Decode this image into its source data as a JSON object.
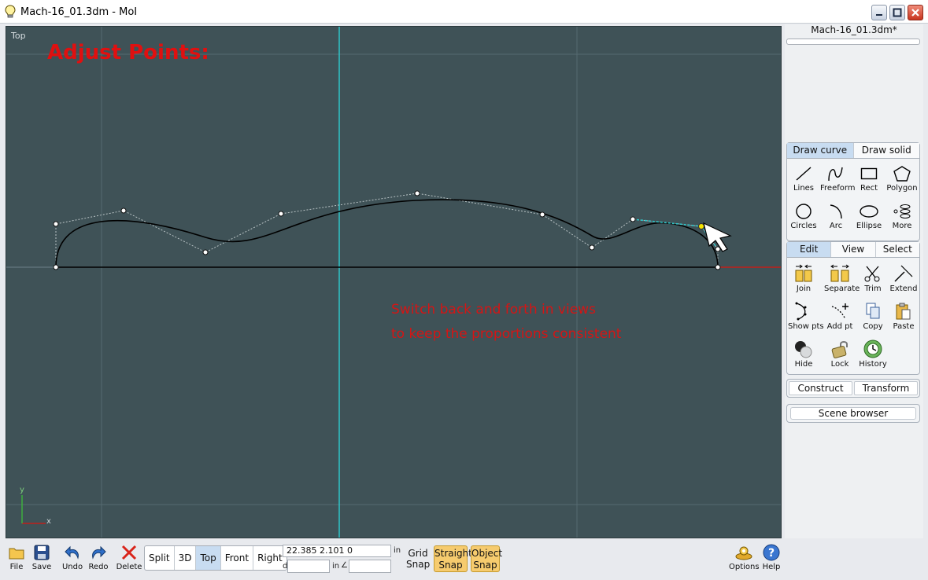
{
  "window": {
    "title": "Mach-16_01.3dm - MoI"
  },
  "viewport": {
    "name": "Top",
    "heading": "Adjust Points:",
    "note_line1": "Switch back and forth in views",
    "note_line2": "to keep the proportions consistent",
    "axis_x": "x",
    "axis_y": "y"
  },
  "panel": {
    "filename": "Mach-16_01.3dm*",
    "draw_tabs": [
      "Draw curve",
      "Draw solid"
    ],
    "draw_tools": [
      "Lines",
      "Freeform",
      "Rect",
      "Polygon",
      "Circles",
      "Arc",
      "Ellipse",
      "More"
    ],
    "edit_tabs": [
      "Edit",
      "View",
      "Select"
    ],
    "edit_tools": [
      "Join",
      "Separate",
      "Trim",
      "Extend",
      "Show pts",
      "Add pt",
      "Copy",
      "Paste",
      "Hide",
      "Lock",
      "History"
    ],
    "construct": "Construct",
    "transform": "Transform",
    "scene_browser": "Scene browser"
  },
  "toolbar": {
    "file": "File",
    "save": "Save",
    "undo": "Undo",
    "redo": "Redo",
    "delete": "Delete",
    "views": [
      "Split",
      "3D",
      "Top",
      "Front",
      "Right"
    ],
    "active_view": "Top",
    "coords": "22.385     2.101       0",
    "unit": "in",
    "distance_label": "d",
    "distance_unit": "in",
    "angle_symbol": "∠",
    "grid_snap_line1": "Grid",
    "grid_snap_line2": "Snap",
    "straight_snap_line1": "Straight",
    "straight_snap_line2": "Snap",
    "object_snap_line1": "Object",
    "object_snap_line2": "Snap",
    "options": "Options",
    "help": "Help"
  },
  "colors": {
    "viewport_bg": "#3f5257",
    "heading_red": "#e01010",
    "axis_cyan": "#2ec5c8",
    "axis_red": "#c0201a",
    "active_tab": "#c8dcf1",
    "snap_on": "#f6cb6e"
  },
  "icons": {
    "app": "lightbulb-icon",
    "minimize": "minimize-icon",
    "maximize": "maximize-icon",
    "close": "close-icon"
  }
}
